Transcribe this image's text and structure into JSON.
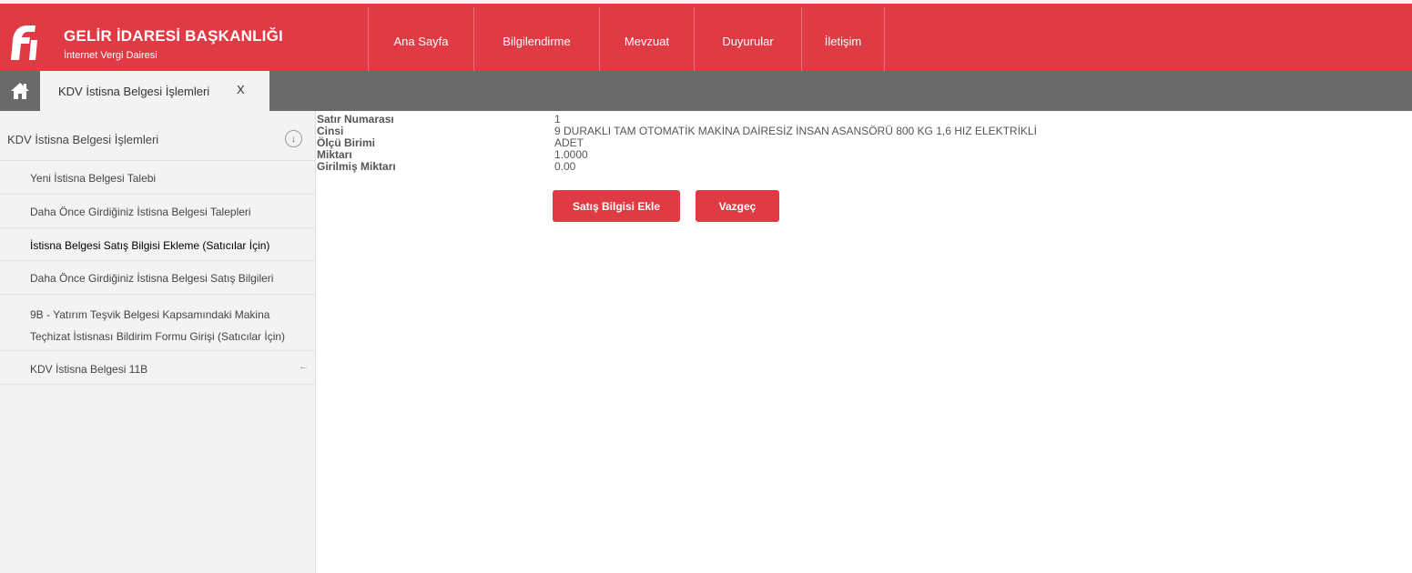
{
  "brand": {
    "title": "GELİR İDARESİ BAŞKANLIĞI",
    "subtitle": "İnternet Vergi Dairesi",
    "logo_icon": "gib-logo-icon"
  },
  "nav": {
    "items": [
      {
        "label": "Ana Sayfa"
      },
      {
        "label": "Bilgilendirme"
      },
      {
        "label": "Mevzuat"
      },
      {
        "label": "Duyurular"
      },
      {
        "label": "İletişim"
      }
    ]
  },
  "tabbar": {
    "home_icon": "home-icon",
    "active_tab": "KDV İstisna Belgesi İşlemleri",
    "close_label": "X"
  },
  "sidebar": {
    "header": "KDV İstisna Belgesi İşlemleri",
    "header_icon": "↓",
    "items": [
      {
        "label": "Yeni İstisna Belgesi Talebi"
      },
      {
        "label": "Daha Önce Girdiğiniz İstisna Belgesi Talepleri"
      },
      {
        "label": "İstisna Belgesi Satış Bilgisi Ekleme (Satıcılar İçin)"
      },
      {
        "label": "Daha Önce Girdiğiniz İstisna Belgesi Satış Bilgileri"
      },
      {
        "label_line1": "9B - Yatırım Teşvik Belgesi Kapsamındaki Makina",
        "label_line2": "Teçhizat İstisnası Bildirim Formu Girişi (Satıcılar İçin)"
      },
      {
        "label": "KDV İstisna Belgesi 11B",
        "arrow": "←"
      }
    ]
  },
  "details": {
    "rows": [
      {
        "key": "Satır Numarası",
        "value": "1"
      },
      {
        "key": "Cinsi",
        "value": "9 DURAKLI TAM OTOMATİK MAKİNA DAİRESİZ İNSAN ASANSÖRÜ 800 KG 1,6 HIZ ELEKTRİKLİ"
      },
      {
        "key": "Ölçü Birimi",
        "value": "ADET"
      },
      {
        "key": "Miktarı",
        "value": "1.0000"
      },
      {
        "key": "Girilmiş Miktarı",
        "value": "0.00"
      }
    ]
  },
  "actions": {
    "add_sale_label": "Satış Bilgisi Ekle",
    "cancel_label": "Vazgeç"
  },
  "colors": {
    "brand_red": "#e03a45",
    "tab_bar_gray": "#6a6a6a",
    "sidebar_bg": "#f3f3f3"
  }
}
